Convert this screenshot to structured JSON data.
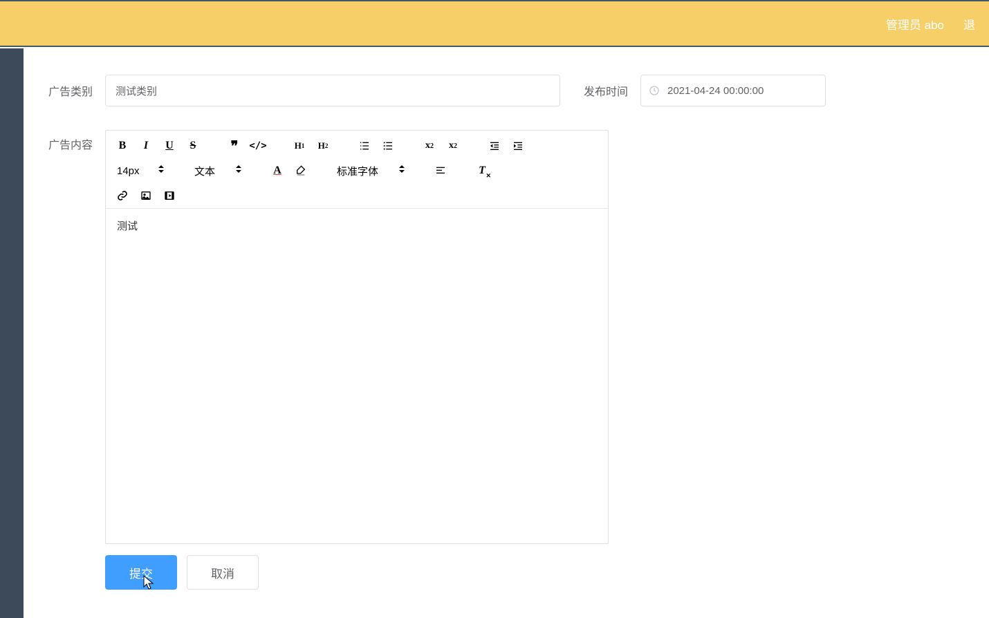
{
  "header": {
    "user_label": "管理员 abo",
    "logout_label": "退"
  },
  "form": {
    "category_label": "广告类别",
    "category_value": "测试类别",
    "publish_time_label": "发布时间",
    "publish_time_value": "2021-04-24 00:00:00",
    "content_label": "广告内容",
    "content_value": "测试"
  },
  "toolbar": {
    "font_size": "14px",
    "paragraph": "文本",
    "font_family": "标准字体"
  },
  "actions": {
    "submit": "提交",
    "cancel": "取消"
  }
}
